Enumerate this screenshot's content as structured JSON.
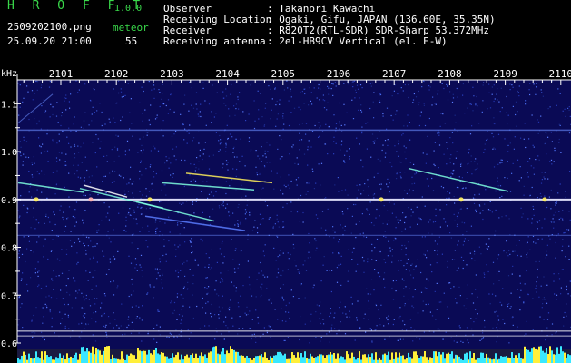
{
  "header": {
    "app_name": "H R O F F T",
    "version": "1.0.0",
    "filename": "2509202100.png",
    "datetime": "25.09.20 21:00",
    "meteor_label": "meteor",
    "meteor_count": "55",
    "fields": [
      {
        "label": "Observer",
        "value": ": Takanori Kawachi"
      },
      {
        "label": "Receiving Location",
        "value": ": Ogaki, Gifu, JAPAN (136.60E, 35.35N)"
      },
      {
        "label": "Receiver",
        "value": ": R820T2(RTL-SDR) SDR-Sharp 53.372MHz"
      },
      {
        "label": "Receiving antenna",
        "value": ": 2el-HB9CV Vertical (el. E-W)"
      }
    ]
  },
  "chart_data": {
    "type": "heatmap",
    "ylabel": "kHz",
    "x_ticks": [
      "2101",
      "2102",
      "2103",
      "2104",
      "2105",
      "2106",
      "2107",
      "2108",
      "2109",
      "2110"
    ],
    "y_ticks": [
      "1.1",
      "1.0",
      "0.9",
      "0.8",
      "0.7",
      "0.6"
    ],
    "ylim": [
      0.6,
      1.15
    ],
    "carrier_khz": 0.9,
    "colors": {
      "background": "#0a0a55",
      "noise": "#3b59d8",
      "carrier": "#e8e8ff",
      "meteor": "#ffef5a",
      "axis": "#ffffff",
      "label": "#39d84a"
    }
  }
}
